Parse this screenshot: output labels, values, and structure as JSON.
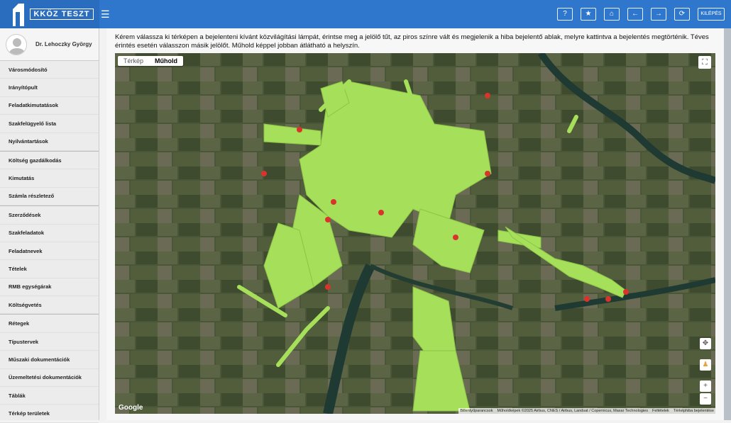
{
  "header": {
    "logo": "KKÖZ TESZT",
    "buttons": [
      "?",
      "★",
      "⌂",
      "←",
      "→",
      "⟳",
      "KILÉPÉS"
    ]
  },
  "user": {
    "name": "Dr. Lehoczky György"
  },
  "sidebar": {
    "groups": [
      [
        "Városmódosító",
        "Irányítópult",
        "Feladatkimutatások",
        "Szakfelügyelő lista",
        "Nyilvántartások"
      ],
      [
        "Költség gazdálkodás",
        "Kimutatás",
        "Számla részletező"
      ],
      [
        "Szerződések",
        "Szakfeladatok",
        "Feladatnevek",
        "Tételek",
        "RMB egységárak",
        "Költségvetés"
      ],
      [
        "Rétegek",
        "Típustervek",
        "Műszaki dokumentációk",
        "Üzemeltetési dokumentációk",
        "Táblák",
        "Térkép területek"
      ]
    ]
  },
  "instruction": "Kérem válassza ki térképen a bejelenteni kívánt közvilágítási lámpát, érintse meg a jelölő tűt, az piros színre vált és megjelenik a hiba bejelentő ablak, melyre kattintva a bejelentés megtörténik. Téves érintés esetén válasszon másik jelölőt. Műhold képpel jobban átlátható a helyszín.",
  "map": {
    "tabs": [
      "Térkép",
      "Műhold"
    ],
    "active_tab": "Műhold",
    "google": "Google",
    "attribution": [
      "Billentyűparancsok",
      "Műholdképek ©2025 Airbus, CNES / Airbus, Landsat / Copernicus, Maxar Technologies",
      "Feltételek",
      "Térképhiba bejelentése"
    ],
    "zoom_in": "+",
    "zoom_out": "−",
    "fullscreen": "⛶"
  },
  "colors": {
    "header": "#2f77cc",
    "marker_green": "#8fd14f",
    "marker_red": "#d9342b"
  }
}
